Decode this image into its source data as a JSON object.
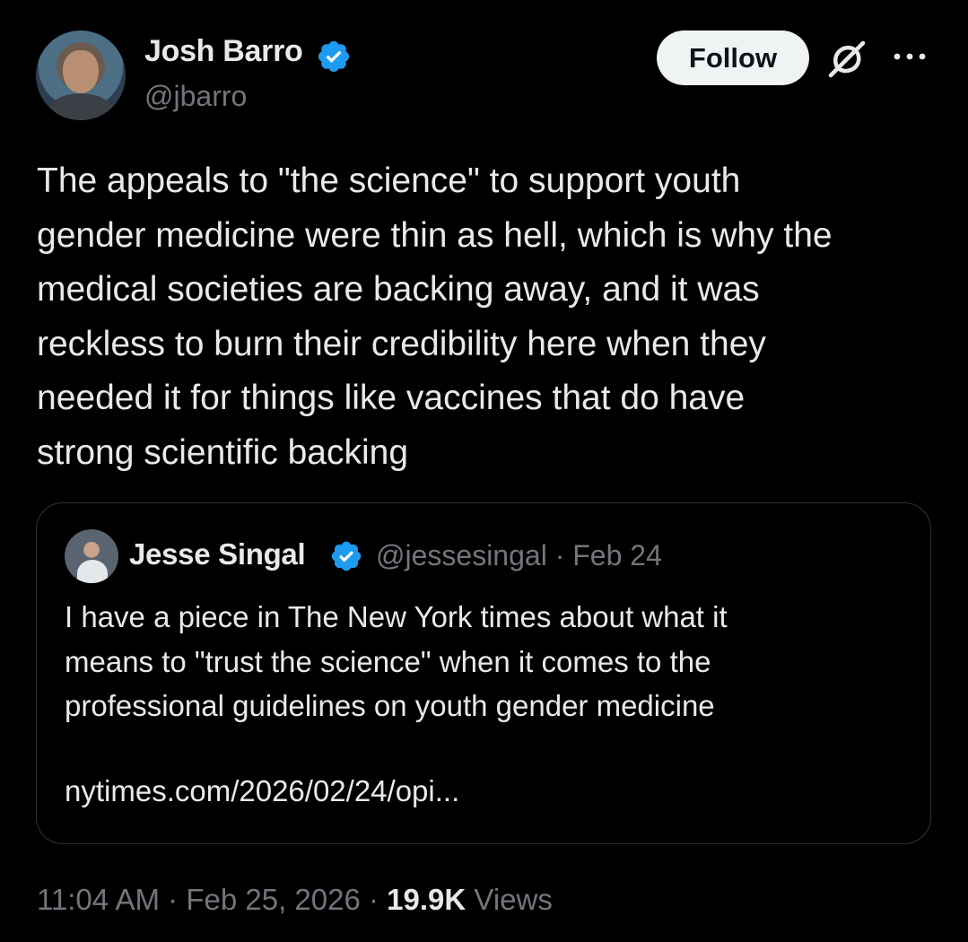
{
  "author": {
    "name": "Josh Barro",
    "handle": "@jbarro"
  },
  "actions": {
    "follow_label": "Follow"
  },
  "tweet": {
    "text": "The appeals to \"the science\" to support youth\ngender medicine were thin as hell, which is why the\nmedical societies are backing away, and it was\nreckless to burn their credibility here when they\nneeded it for things like vaccines that do have\nstrong scientific backing",
    "time": "11:04 AM",
    "date": "Feb 25, 2026",
    "views_count": "19.9K",
    "views_label": "Views"
  },
  "quote": {
    "name": "Jesse Singal",
    "handle": "@jessesingal",
    "date": "Feb 24",
    "text": "I have a piece in The New York times about what it\nmeans to \"trust the science\" when it comes to the\nprofessional guidelines on youth gender medicine",
    "link": "nytimes.com/2026/02/24/opi..."
  },
  "colors": {
    "background": "#000000",
    "text": "#e7e9ea",
    "secondary_text": "#71767b",
    "verified_badge": "#1d9bf0",
    "border": "#2f3336",
    "follow_button_bg": "#eff3f4"
  },
  "icons": {
    "verified": "verified-badge-icon",
    "grok": "grok-icon",
    "more": "more-dots-icon"
  }
}
